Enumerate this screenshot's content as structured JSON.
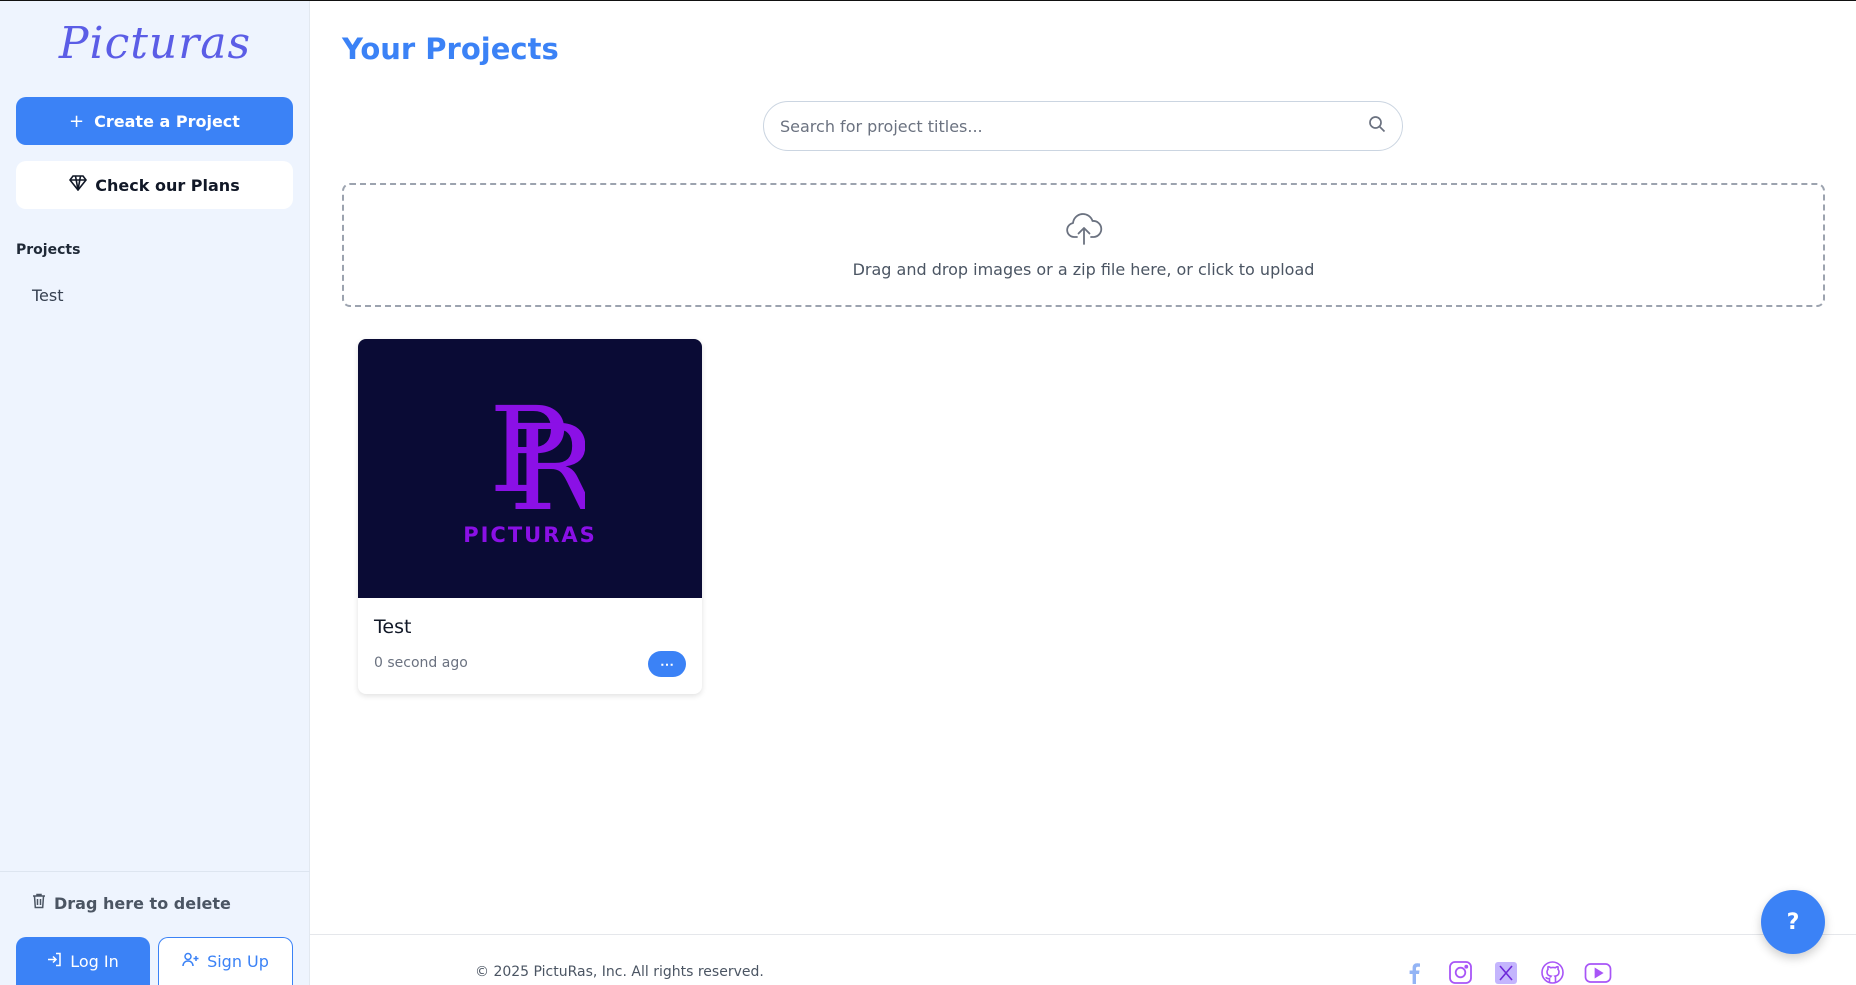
{
  "sidebar": {
    "logo": "Picturas",
    "create_label": "Create a Project",
    "plans_label": "Check our Plans",
    "projects_heading": "Projects",
    "projects": [
      "Test"
    ],
    "delete_label": "Drag here to delete",
    "login_label": "Log In",
    "signup_label": "Sign Up"
  },
  "main": {
    "title": "Your Projects",
    "search_placeholder": "Search for project titles...",
    "upload_text": "Drag and drop images or a zip file here, or click to upload",
    "cards": [
      {
        "title": "Test",
        "time": "0 second ago",
        "thumb_brand": "PICTURAS",
        "menu_label": "⋯"
      }
    ]
  },
  "footer": {
    "copyright": "© 2025 PictuRas, Inc. All rights reserved.",
    "socials": [
      "facebook-icon",
      "instagram-icon",
      "x-icon",
      "github-icon",
      "youtube-icon"
    ]
  },
  "help_label": "?",
  "colors": {
    "accent": "#3b82f6",
    "sidebar_bg": "#eef4fe",
    "thumb_bg": "#0a0b35",
    "thumb_brand": "#8b10e6",
    "logo": "#5b5de6"
  }
}
